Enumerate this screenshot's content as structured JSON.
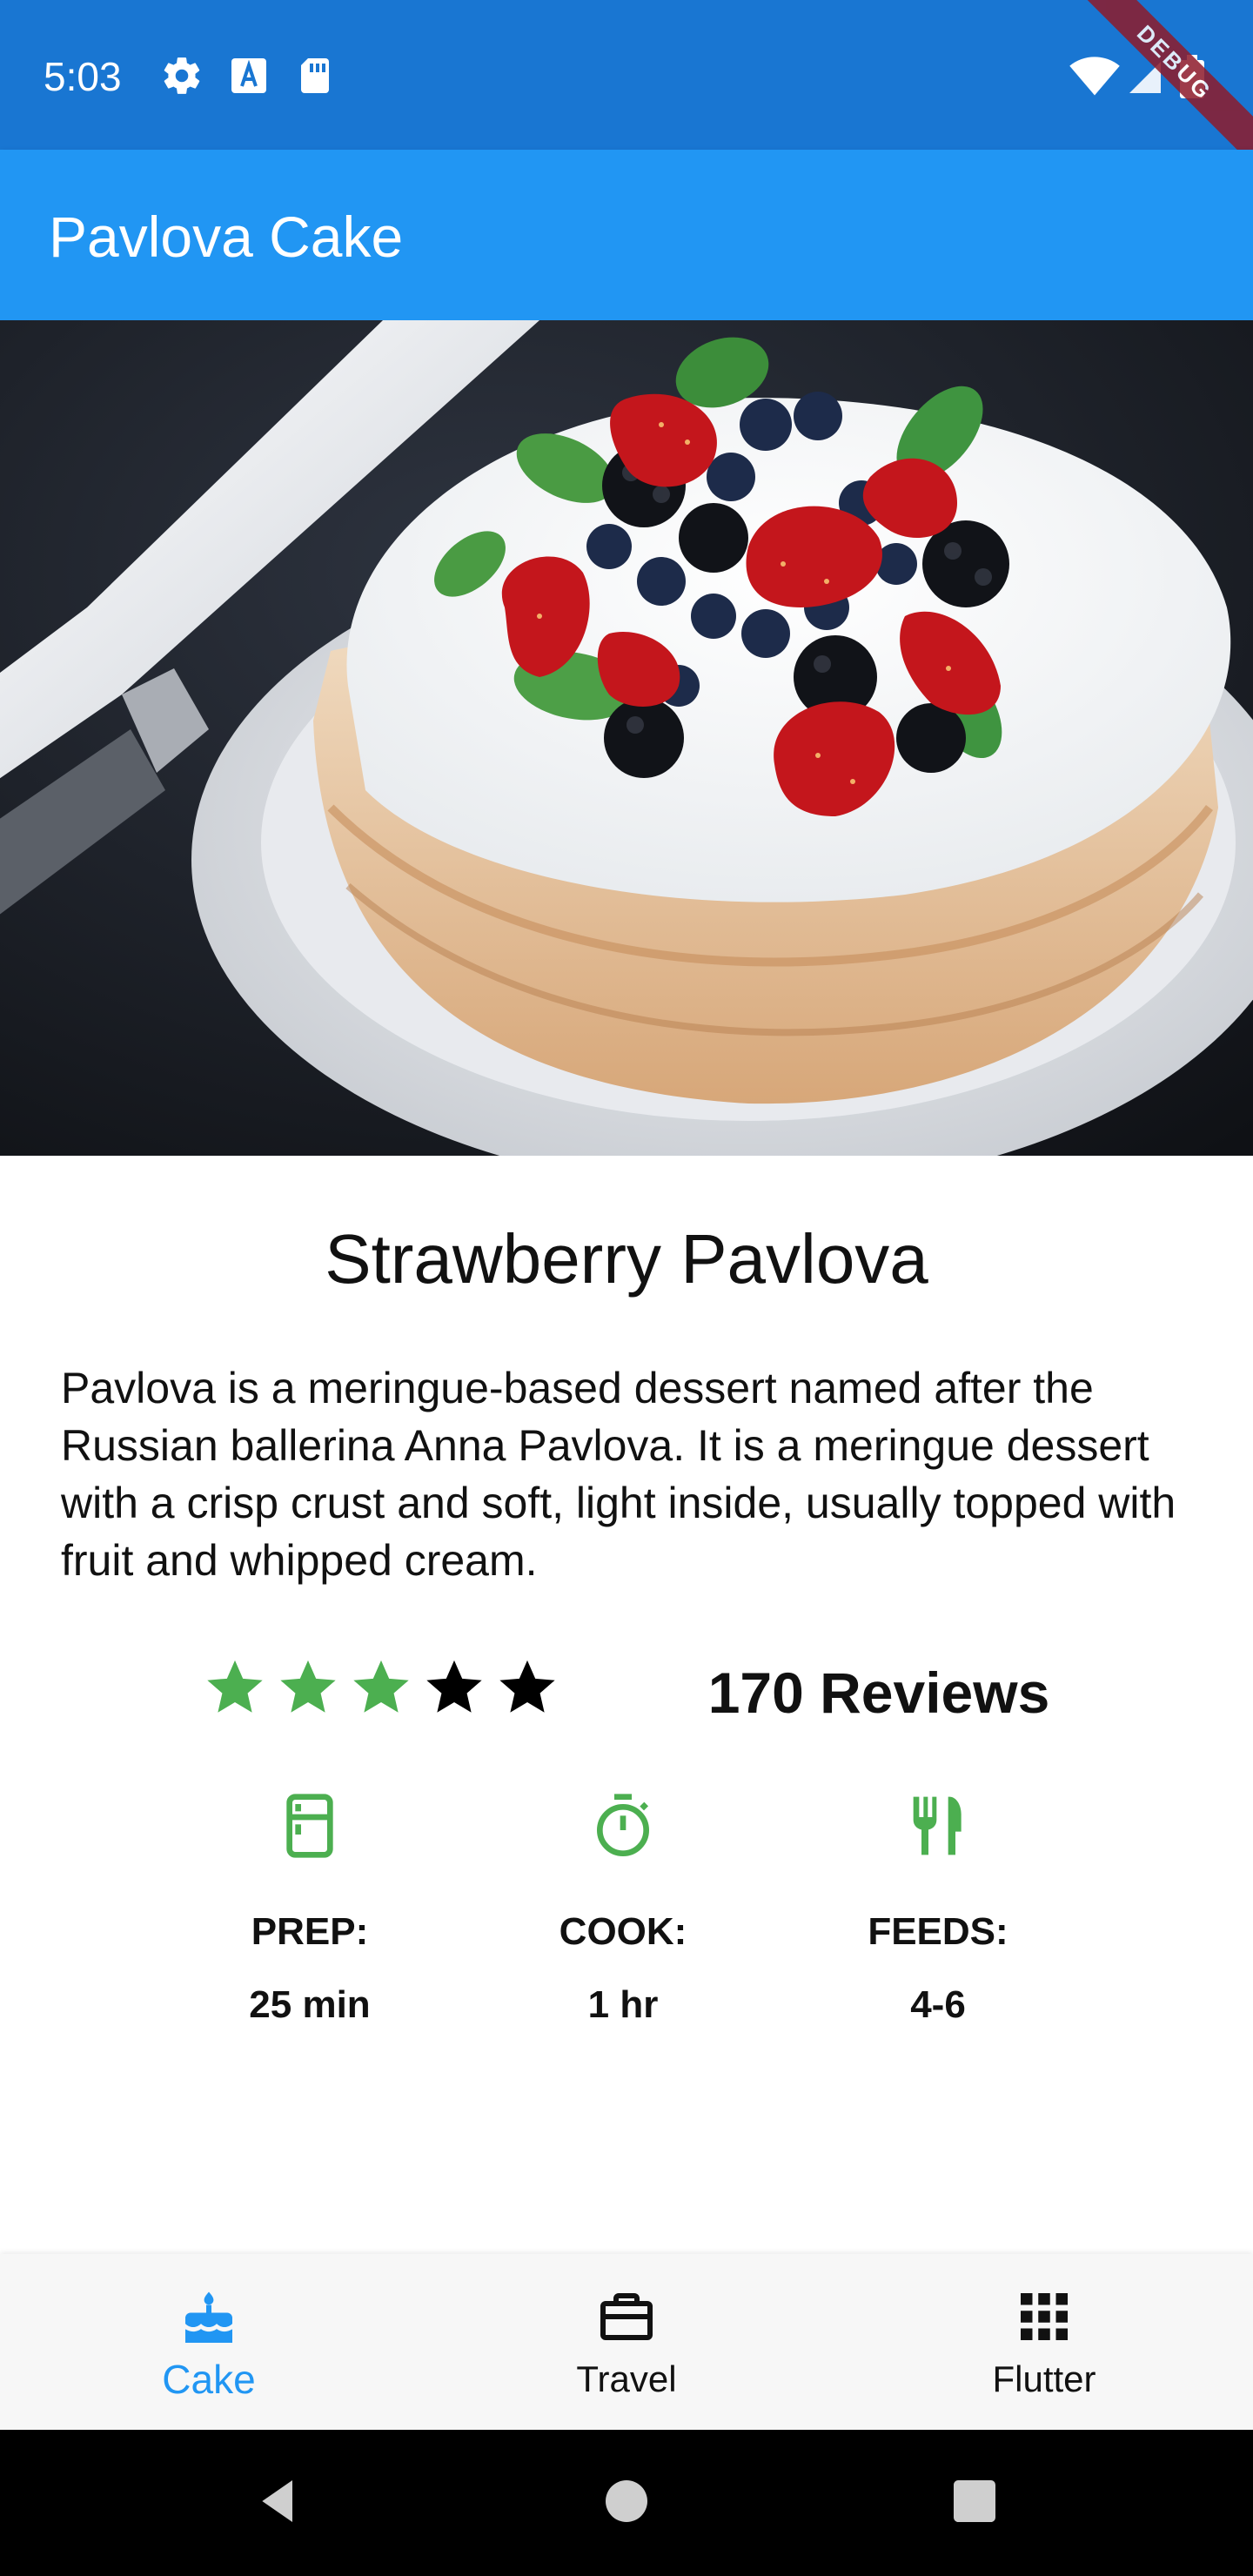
{
  "status_bar": {
    "time": "5:03",
    "icons": [
      "gear-icon",
      "font-download-icon",
      "sd-card-icon",
      "wifi-icon",
      "signal-icon",
      "battery-icon"
    ],
    "debug_label": "DEBUG",
    "bg_color": "#1976d2"
  },
  "app_bar": {
    "title": "Pavlova Cake",
    "bg_color": "#2196f3"
  },
  "hero": {
    "icon": "pavlova-cake-photo"
  },
  "recipe": {
    "title": "Strawberry Pavlova",
    "description": "Pavlova is a meringue-based dessert named after the Russian ballerina Anna Pavlova. It is a meringue dessert with a crisp crust and soft, light inside, usually topped with fruit and whipped cream.",
    "rating": 3,
    "rating_max": 5,
    "reviews": "170 Reviews",
    "accent_color": "#4caf50"
  },
  "info": [
    {
      "icon": "kitchen-icon",
      "label": "PREP:",
      "value": "25 min"
    },
    {
      "icon": "timer-icon",
      "label": "COOK:",
      "value": "1 hr"
    },
    {
      "icon": "restaurant-icon",
      "label": "FEEDS:",
      "value": "4-6"
    }
  ],
  "bottom_nav": {
    "items": [
      {
        "icon": "cake-icon",
        "label": "Cake",
        "active": true
      },
      {
        "icon": "work-icon",
        "label": "Travel",
        "active": false
      },
      {
        "icon": "apps-icon",
        "label": "Flutter",
        "active": false
      }
    ],
    "active_color": "#2196f3"
  },
  "system_nav": {
    "buttons": [
      "back-icon",
      "home-icon",
      "recents-icon"
    ]
  }
}
